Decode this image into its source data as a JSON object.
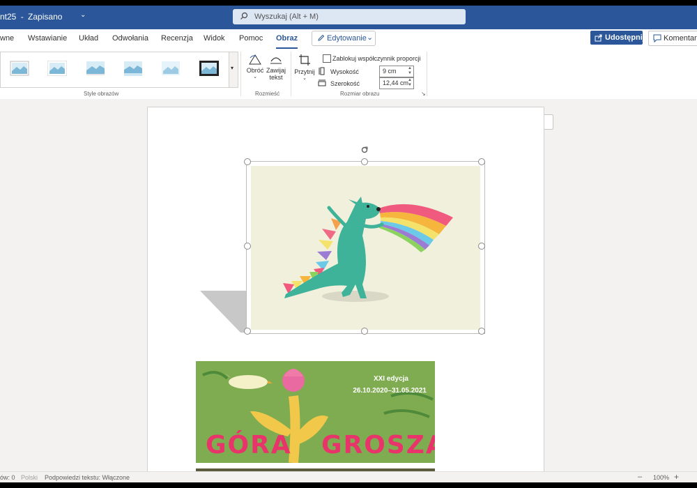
{
  "titlebar": {
    "document_name": "nt25",
    "separator": "-",
    "save_status": "Zapisano"
  },
  "search": {
    "placeholder": "Wyszukaj (Alt + M)"
  },
  "tabs": [
    "wne",
    "Wstawianie",
    "Układ",
    "Odwołania",
    "Recenzja",
    "Widok",
    "Pomoc",
    "Obraz"
  ],
  "active_tab": "Obraz",
  "mode_button": {
    "label": "Edytowanie"
  },
  "share_button": {
    "label": "Udostępnij"
  },
  "comments_button": {
    "label": "Komentarz"
  },
  "ribbon": {
    "group_styles": "Style obrazów",
    "rotate_label": "Obróć",
    "wrap_label_1": "Zawijaj",
    "wrap_label_2": "tekst",
    "group_arrange": "Rozmieść",
    "crop_label": "Przytnij",
    "lock_ratio_label": "Zablokuj współczynnik proporcji",
    "height_label": "Wysokość",
    "height_value": "9 cm",
    "width_label": "Szerokość",
    "width_value": "12,44 cm",
    "group_size": "Rozmiar obrazu"
  },
  "banner": {
    "edition": "XXI edycja",
    "dates": "26.10.2020–31.05.2021",
    "title_left": "GÓRA",
    "title_right": "GROSZA"
  },
  "statusbar": {
    "words": "ów: 0",
    "language": "Polski",
    "text_predictions": "Podpowiedzi tekstu: Włączone",
    "zoom": "100%"
  },
  "colors": {
    "brand": "#2b579a",
    "accent_pink": "#e8346b",
    "banner_green": "#7fac50",
    "image_bg": "#f1f0dc",
    "dino": "#3eb39a"
  }
}
